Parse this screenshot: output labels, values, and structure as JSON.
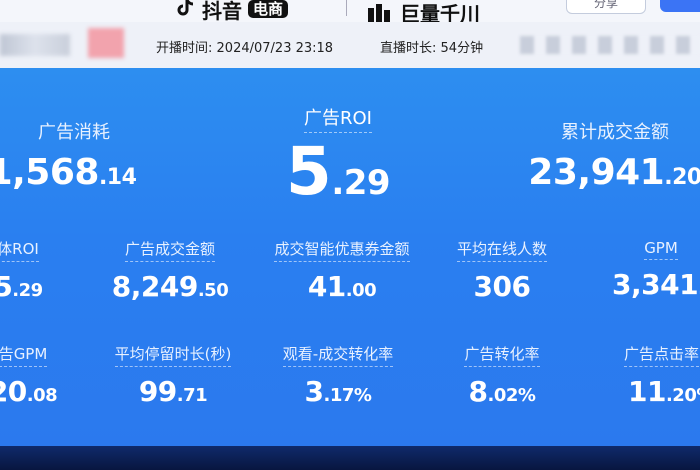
{
  "header": {
    "douyin_logo_text": "抖音",
    "ecommerce_tag": "电商",
    "juliang_logo_text": "巨量千川",
    "outline_button_label": "分享"
  },
  "info": {
    "start_time_label": "开播时间:",
    "start_time_value": "2024/07/23 23:18",
    "duration_label": "直播时长:",
    "duration_value": "54分钟"
  },
  "metrics": {
    "ad_spend": {
      "label": "广告消耗",
      "int": "1,568",
      "dec": ".14"
    },
    "ad_roi": {
      "label": "广告ROI",
      "int": "5",
      "dec": ".29"
    },
    "gmv_total": {
      "label": "累计成交金额",
      "int": "23,941",
      "dec": ".20"
    },
    "overall_roi": {
      "label": "体ROI",
      "int": "5",
      "dec": ".29"
    },
    "ad_gmv": {
      "label": "广告成交金额",
      "int": "8,249",
      "dec": ".50"
    },
    "coupon_amount": {
      "label": "成交智能优惠券金额",
      "int": "41",
      "dec": ".00"
    },
    "avg_online": {
      "label": "平均在线人数",
      "int": "306",
      "dec": ""
    },
    "gpm": {
      "label": "GPM",
      "int": "3,341",
      "dec": "."
    },
    "ad_gpm": {
      "label": "告GPM",
      "int": "20",
      "dec": ".08"
    },
    "avg_stay": {
      "label": "平均停留时长(秒)",
      "int": "99",
      "dec": ".71"
    },
    "view_conversion": {
      "label": "观看-成交转化率",
      "int": "3",
      "dec": ".17%"
    },
    "ad_conversion": {
      "label": "广告转化率",
      "int": "8",
      "dec": ".02%"
    },
    "ad_ctr": {
      "label": "广告点击率",
      "int": "11",
      "dec": ".20%"
    }
  },
  "colors": {
    "panel_blue": "#2b83f0",
    "header_bg": "#f4f6fb",
    "accent_button": "#3b74f5"
  }
}
